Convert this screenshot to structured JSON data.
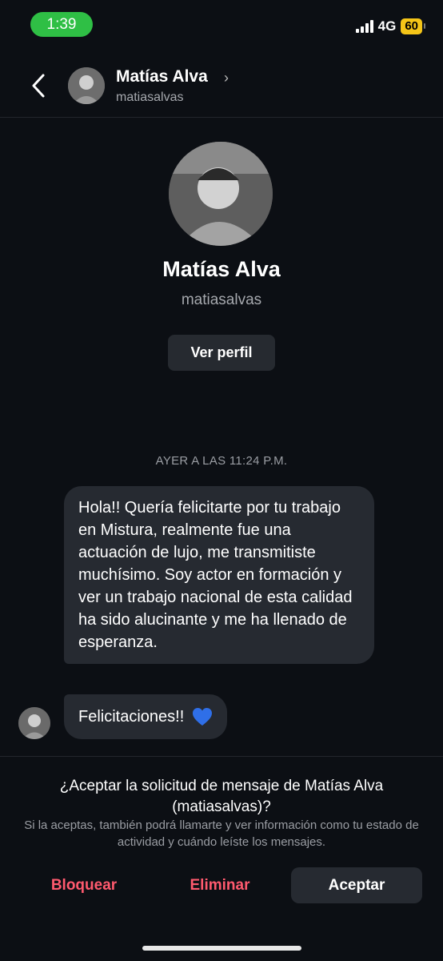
{
  "status_bar": {
    "time": "1:39",
    "network": "4G",
    "battery": "60"
  },
  "header": {
    "name": "Matías Alva",
    "username": "matiasalvas"
  },
  "profile": {
    "name": "Matías Alva",
    "username": "matiasalvas",
    "view_profile_label": "Ver perfil"
  },
  "conversation": {
    "timestamp": "AYER A LAS 11:24 P.M.",
    "messages": [
      {
        "text": "Hola!! Quería felicitarte por tu trabajo en Mistura, realmente fue una actuación de lujo, me transmitiste muchísimo. Soy actor en formación y ver un trabajo nacional de esta calidad ha sido alucinante y me ha llenado de esperanza."
      },
      {
        "text": "Felicitaciones!!",
        "emoji": "blue-heart"
      }
    ]
  },
  "request": {
    "title": "¿Aceptar la solicitud de mensaje de Matías Alva (matiasalvas)?",
    "description": "Si la aceptas, también podrá llamarte y ver información como tu estado de actividad y cuándo leíste los mensajes.",
    "block_label": "Bloquear",
    "delete_label": "Eliminar",
    "accept_label": "Aceptar"
  },
  "colors": {
    "accent_red": "#ff5a6e",
    "status_green": "#2fbf45",
    "battery_yellow": "#f5c518",
    "bubble": "#262a31",
    "heart": "#2f6fe8"
  }
}
